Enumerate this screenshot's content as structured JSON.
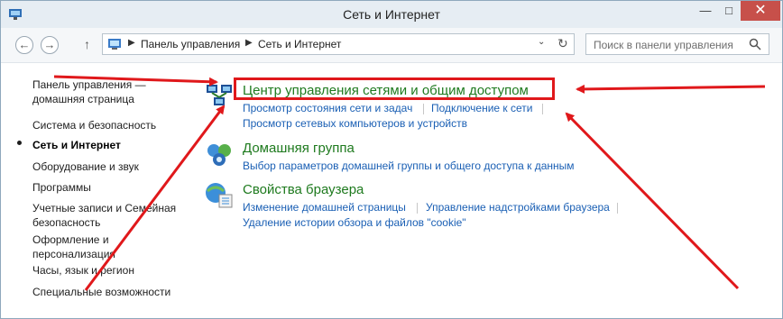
{
  "window": {
    "title": "Сеть и Интернет",
    "controls": {
      "minimize": "—",
      "maximize": "□",
      "close": "✕"
    }
  },
  "nav": {
    "back": "←",
    "forward": "→",
    "up": "↑",
    "breadcrumb": [
      "Панель управления",
      "Сеть и Интернет"
    ],
    "dropdown": "⌄",
    "refresh": "↻"
  },
  "search": {
    "placeholder": "Поиск в панели управления"
  },
  "sidebar": {
    "home_line1": "Панель управления —",
    "home_line2": "домашняя страница",
    "items": [
      {
        "label": "Система и безопасность"
      },
      {
        "label": "Сеть и Интернет",
        "current": true
      },
      {
        "label": "Оборудование и звук"
      },
      {
        "label": "Программы"
      },
      {
        "label_line1": "Учетные записи и Семейная",
        "label_line2": "безопасность"
      },
      {
        "label_line1": "Оформление и",
        "label_line2": "персонализация"
      },
      {
        "label": "Часы, язык и регион"
      },
      {
        "label": "Специальные возможности"
      }
    ]
  },
  "sections": [
    {
      "title": "Центр управления сетями и общим доступом",
      "icon": "network-center-icon",
      "links": [
        "Просмотр состояния сети и задач",
        "Подключение к сети",
        "Просмотр сетевых компьютеров и устройств"
      ]
    },
    {
      "title": "Домашняя группа",
      "icon": "homegroup-icon",
      "links": [
        "Выбор параметров домашней группы и общего доступа к данным"
      ]
    },
    {
      "title": "Свойства браузера",
      "icon": "browser-options-icon",
      "links": [
        "Изменение домашней страницы",
        "Управление надстройками браузера",
        "Удаление истории обзора и файлов \"cookie\""
      ]
    }
  ],
  "colors": {
    "accent_link": "#1a5fb4",
    "section_title": "#1e7a1e",
    "annotation": "#e0181b",
    "close_button": "#c7504a"
  }
}
